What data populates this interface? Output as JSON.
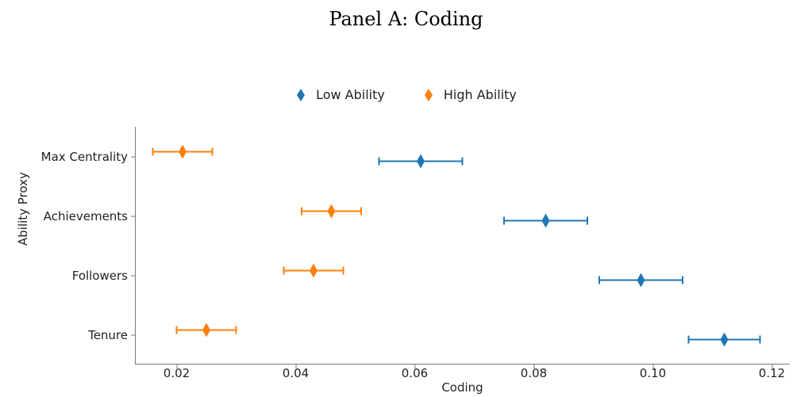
{
  "title": "Panel A: Coding",
  "xlabel": "Coding",
  "ylabel": "Ability Proxy",
  "legend": {
    "low": {
      "label": "Low Ability",
      "color": "#1f77b4"
    },
    "high": {
      "label": "High Ability",
      "color": "#ff7f0e"
    }
  },
  "x_ticks": [
    0.02,
    0.04,
    0.06,
    0.08,
    0.1,
    0.12
  ],
  "y_categories": [
    "Max Centrality",
    "Achievements",
    "Followers",
    "Tenure"
  ],
  "x_range": [
    0.013,
    0.123
  ],
  "chart_data": {
    "type": "scatter",
    "title": "Panel A: Coding",
    "xlabel": "Coding",
    "ylabel": "Ability Proxy",
    "categories": [
      "Max Centrality",
      "Achievements",
      "Followers",
      "Tenure"
    ],
    "x_ticks": [
      0.02,
      0.04,
      0.06,
      0.08,
      0.1,
      0.12
    ],
    "series": [
      {
        "name": "Low Ability",
        "color": "#1f77b4",
        "points": [
          {
            "category": "Max Centrality",
            "x": 0.061,
            "err": 0.007
          },
          {
            "category": "Achievements",
            "x": 0.082,
            "err": 0.007
          },
          {
            "category": "Followers",
            "x": 0.098,
            "err": 0.007
          },
          {
            "category": "Tenure",
            "x": 0.112,
            "err": 0.006
          }
        ]
      },
      {
        "name": "High Ability",
        "color": "#ff7f0e",
        "points": [
          {
            "category": "Max Centrality",
            "x": 0.021,
            "err": 0.005
          },
          {
            "category": "Achievements",
            "x": 0.046,
            "err": 0.005
          },
          {
            "category": "Followers",
            "x": 0.043,
            "err": 0.005
          },
          {
            "category": "Tenure",
            "x": 0.025,
            "err": 0.005
          }
        ]
      }
    ],
    "dodge": 0.08
  }
}
